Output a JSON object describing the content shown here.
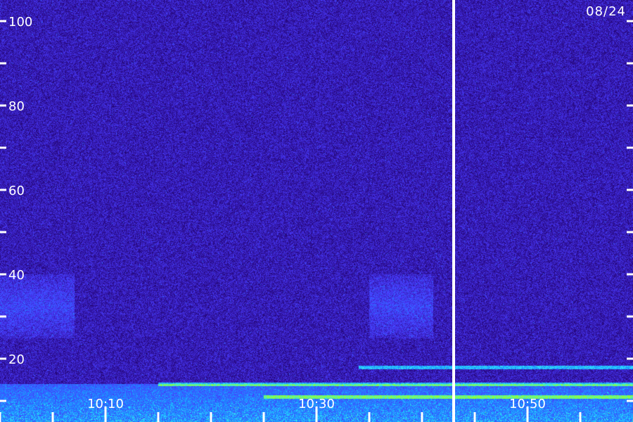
{
  "chart_data": {
    "type": "heatmap",
    "title": "",
    "date_label": "08/24",
    "x": {
      "tick_labels": [
        "10:10",
        "10:30",
        "10:50"
      ],
      "tick_values_min": [
        10,
        30,
        50
      ],
      "range_min": [
        0,
        60
      ],
      "minor_ticks_min": [
        0,
        5,
        10,
        15,
        20,
        25,
        30,
        35,
        40,
        45,
        50,
        55
      ]
    },
    "y": {
      "tick_labels": [
        "20",
        "40",
        "60",
        "80",
        "100"
      ],
      "tick_values": [
        20,
        40,
        60,
        80,
        100
      ],
      "minor_ticks": [
        10,
        30,
        50,
        70,
        90
      ],
      "range": [
        5,
        105
      ]
    },
    "data_gap_at_min": 43,
    "features": [
      {
        "kind": "broadband-enhancement",
        "time_range_min": [
          0,
          7
        ],
        "freq_range": [
          25,
          40
        ]
      },
      {
        "kind": "broadband-enhancement",
        "time_range_min": [
          35,
          41
        ],
        "freq_range": [
          25,
          40
        ]
      },
      {
        "kind": "low-frequency-band",
        "time_range_min": [
          0,
          60
        ],
        "freq_range": [
          5,
          14
        ]
      },
      {
        "kind": "narrowband-line",
        "time_range_min": [
          34,
          60
        ],
        "freq": 18
      },
      {
        "kind": "narrowband-line",
        "time_range_min": [
          15,
          60
        ],
        "freq": 14
      },
      {
        "kind": "narrowband-line",
        "time_range_min": [
          25,
          60
        ],
        "freq": 11
      }
    ],
    "colorscale": [
      "#0a0418",
      "#2a0a8a",
      "#4a3cff",
      "#1a8cff",
      "#2ee8ff",
      "#8dff3a"
    ],
    "grid": false
  }
}
